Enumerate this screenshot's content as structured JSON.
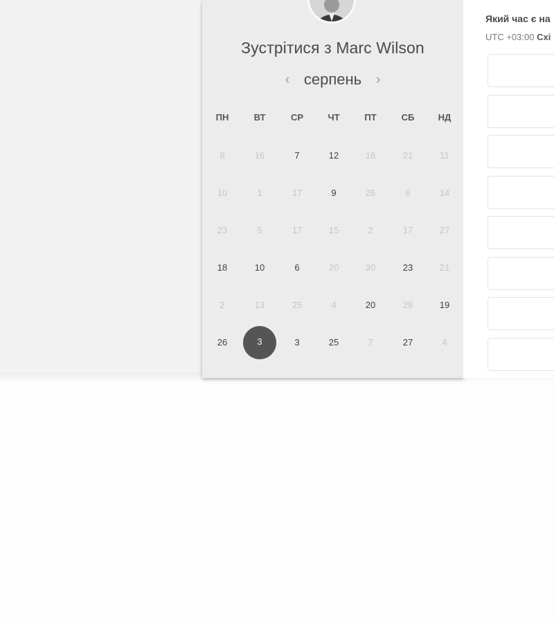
{
  "meeting": {
    "title": "Зустрітися з Marc Wilson",
    "avatar_icon": "person-avatar"
  },
  "calendar": {
    "month": "серпень",
    "prev_icon": "‹",
    "next_icon": "›",
    "weekdays": [
      "ПН",
      "ВТ",
      "СР",
      "ЧТ",
      "ПТ",
      "СБ",
      "НД"
    ],
    "weeks": [
      [
        {
          "d": "8",
          "e": false
        },
        {
          "d": "16",
          "e": false
        },
        {
          "d": "7",
          "e": true
        },
        {
          "d": "12",
          "e": true
        },
        {
          "d": "16",
          "e": false
        },
        {
          "d": "21",
          "e": false
        },
        {
          "d": "11",
          "e": false
        }
      ],
      [
        {
          "d": "10",
          "e": false
        },
        {
          "d": "1",
          "e": false
        },
        {
          "d": "17",
          "e": false
        },
        {
          "d": "9",
          "e": true
        },
        {
          "d": "26",
          "e": false
        },
        {
          "d": "6",
          "e": false
        },
        {
          "d": "14",
          "e": false
        }
      ],
      [
        {
          "d": "23",
          "e": false
        },
        {
          "d": "5",
          "e": false
        },
        {
          "d": "17",
          "e": false
        },
        {
          "d": "15",
          "e": false
        },
        {
          "d": "2",
          "e": false
        },
        {
          "d": "17",
          "e": false
        },
        {
          "d": "27",
          "e": false
        }
      ],
      [
        {
          "d": "18",
          "e": true
        },
        {
          "d": "10",
          "e": true
        },
        {
          "d": "6",
          "e": true
        },
        {
          "d": "20",
          "e": false
        },
        {
          "d": "30",
          "e": false
        },
        {
          "d": "23",
          "e": true
        },
        {
          "d": "21",
          "e": false
        }
      ],
      [
        {
          "d": "2",
          "e": false
        },
        {
          "d": "13",
          "e": false
        },
        {
          "d": "25",
          "e": false
        },
        {
          "d": "4",
          "e": false
        },
        {
          "d": "20",
          "e": true
        },
        {
          "d": "28",
          "e": false
        },
        {
          "d": "19",
          "e": true
        }
      ],
      [
        {
          "d": "26",
          "e": true
        },
        {
          "d": "3",
          "e": true,
          "selected": true
        },
        {
          "d": "3",
          "e": true
        },
        {
          "d": "25",
          "e": true
        },
        {
          "d": "7",
          "e": false
        },
        {
          "d": "27",
          "e": true
        },
        {
          "d": "4",
          "e": false
        }
      ]
    ],
    "selected_color": "#555555"
  },
  "timezone": {
    "question": "Який час є на",
    "utc": "UTC +03:00",
    "zone": "Схі"
  },
  "slots": [
    "",
    "",
    "",
    "",
    "",
    "",
    "",
    ""
  ]
}
